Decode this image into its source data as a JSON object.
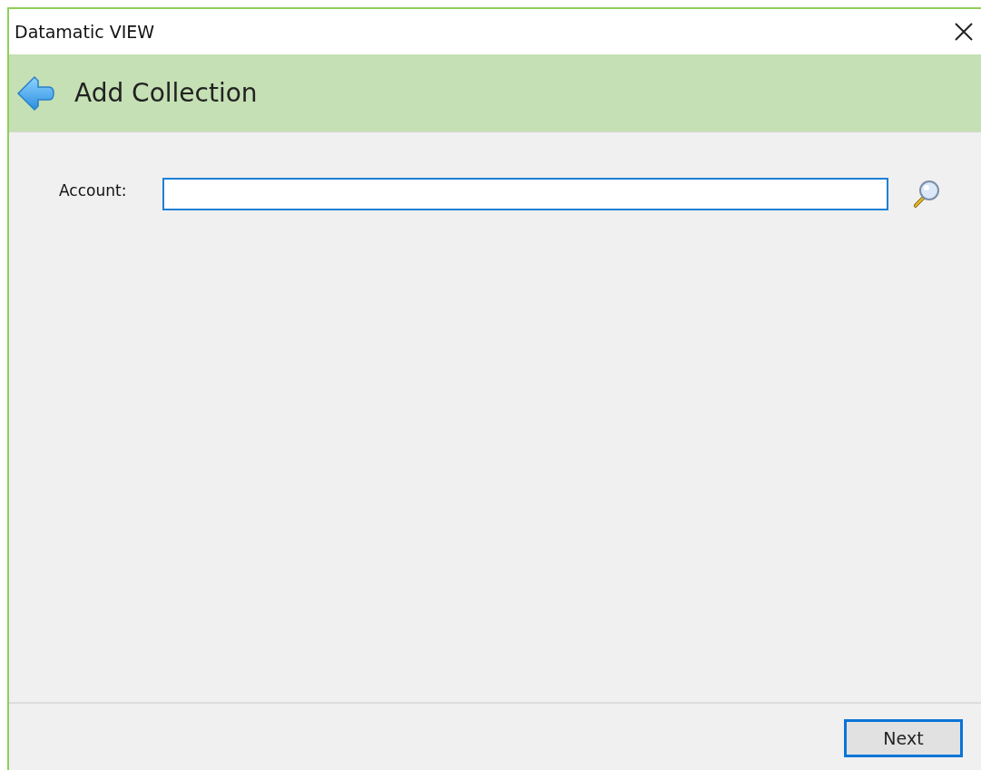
{
  "window": {
    "title": "Datamatic VIEW"
  },
  "header": {
    "title": "Add Collection"
  },
  "fields": [
    {
      "label": "Account:",
      "focused": true
    }
  ],
  "buttons": [
    {
      "label": "Next",
      "focused": true
    }
  ]
}
